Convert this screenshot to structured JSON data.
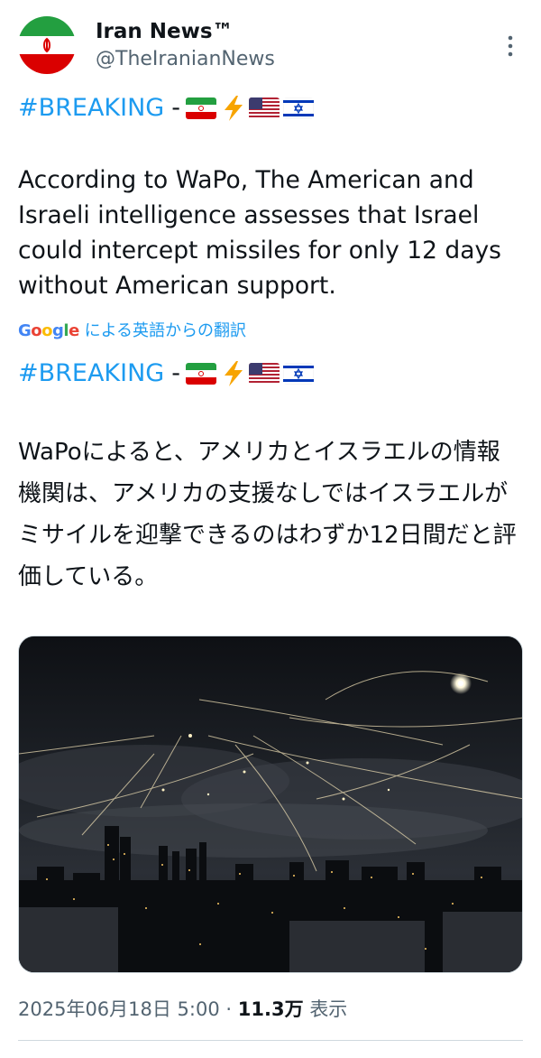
{
  "author": {
    "name": "Iran News™",
    "handle": "@TheIranianNews"
  },
  "tweet": {
    "hashtag": "#BREAKING",
    "separator": "-",
    "emoji": [
      "iran-flag",
      "lightning",
      "us-flag",
      "israel-flag"
    ],
    "text_en": "According to WaPo, The American and Israeli intelligence assesses that Israel could intercept missiles for only 12 days without American support.",
    "translate_label": "による英語からの翻訳",
    "translate_brand": "Google",
    "text_ja": "WaPoによると、アメリカとイスラエルの情報機関は、アメリカの支援なしではイスラエルがミサイルを迎撃できるのはわずか12日間だと評価している。"
  },
  "meta": {
    "timestamp": "2025年06月18日 5:00",
    "dot": "·",
    "views_count": "11.3万",
    "views_label": "表示"
  },
  "colors": {
    "link": "#1d9bf0",
    "text": "#0f1419",
    "secondary": "#536471",
    "border": "#cfd9de"
  }
}
